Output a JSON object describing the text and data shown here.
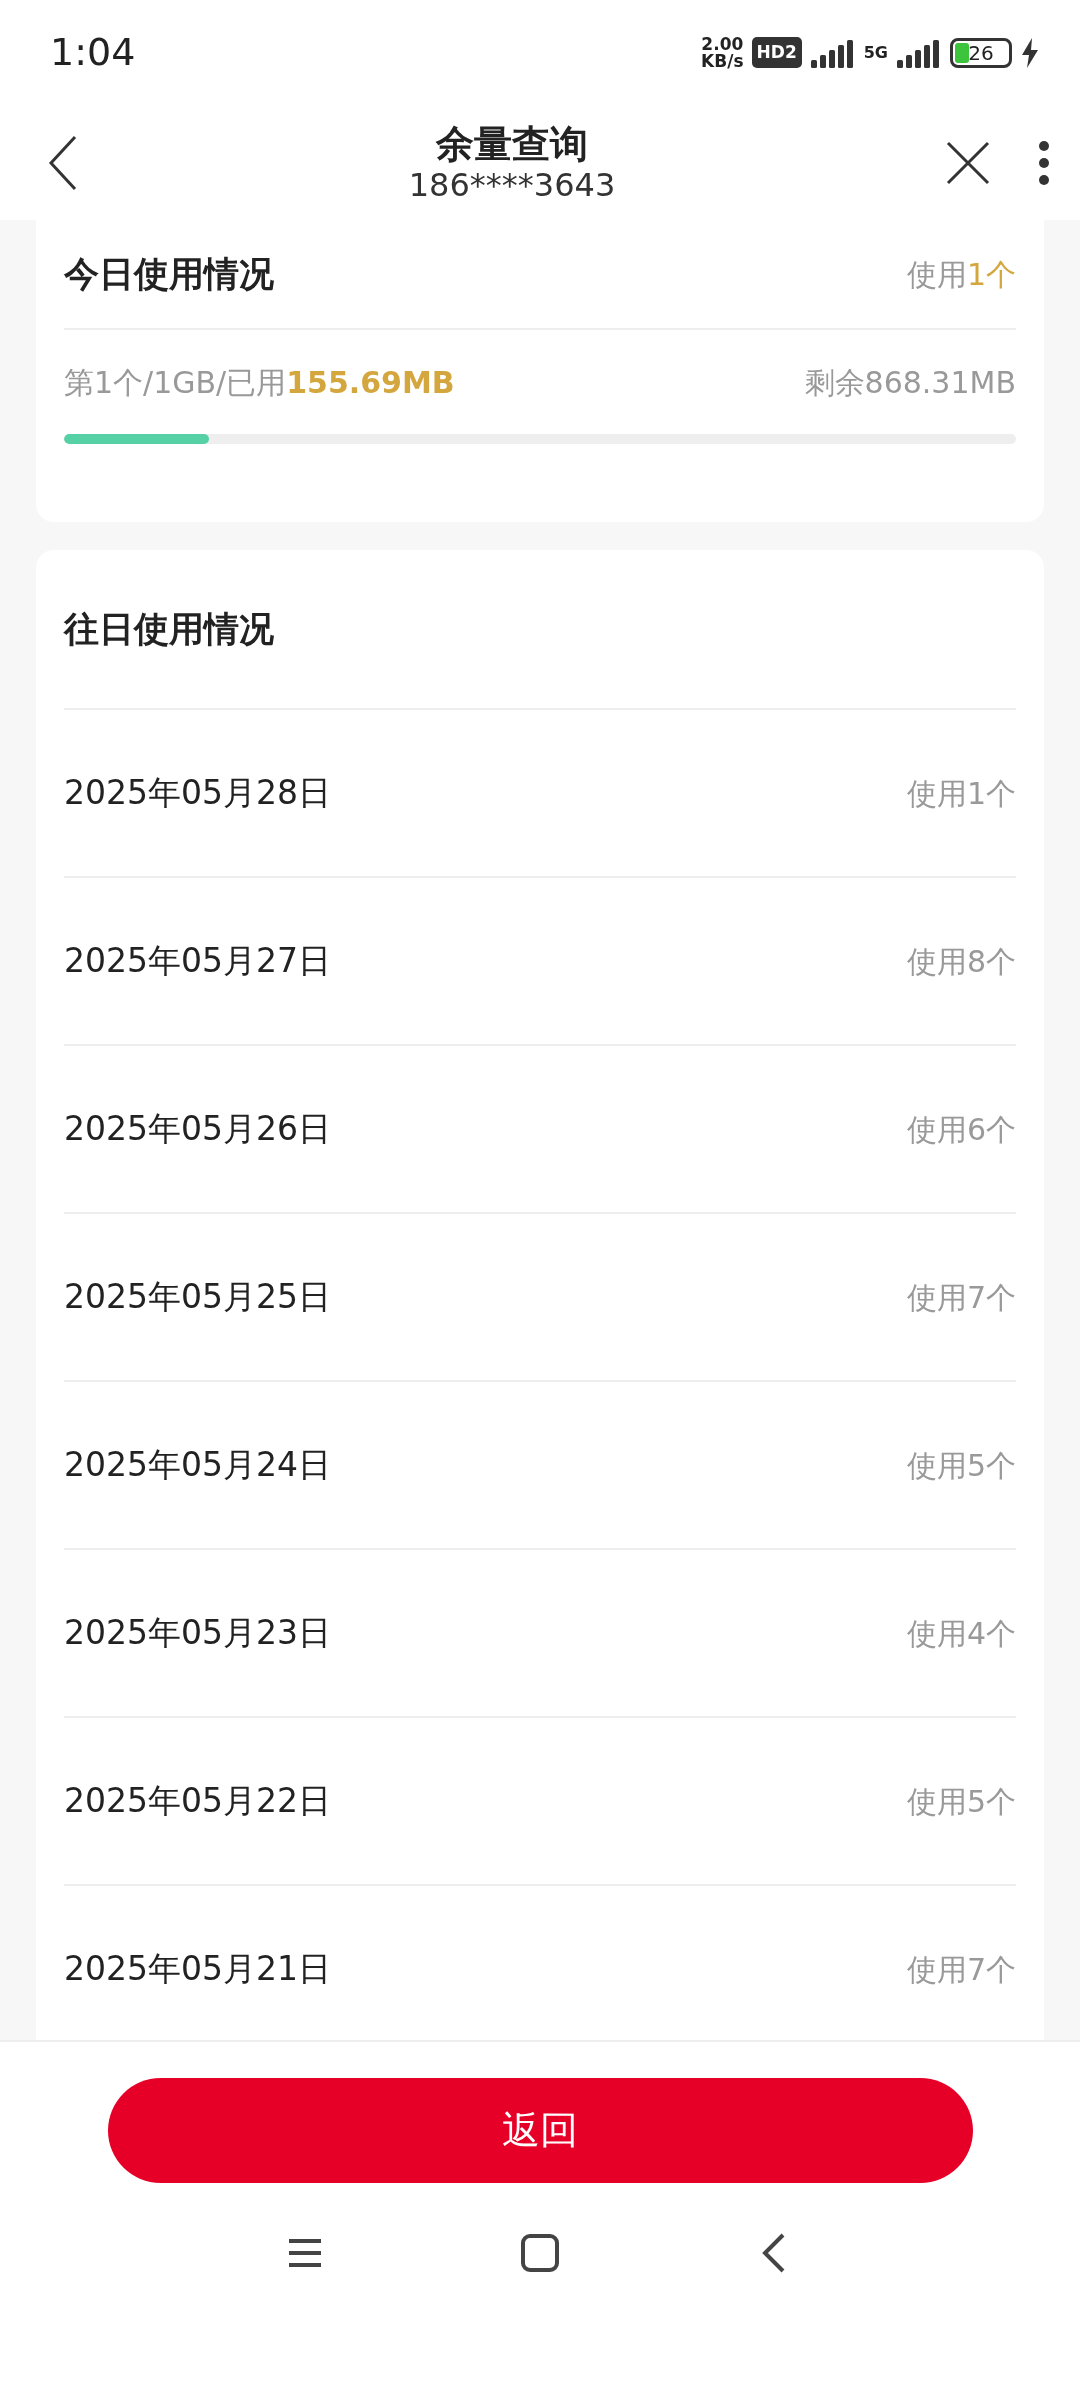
{
  "status_bar": {
    "time": "1:04",
    "speed_value": "2.00",
    "speed_unit": "KB/s",
    "hd_badge": "HD2",
    "network": "5G",
    "battery": "26",
    "charging": true
  },
  "header": {
    "title": "余量查询",
    "subtitle": "186****3643"
  },
  "today": {
    "title": "今日使用情况",
    "usage_prefix": "使用",
    "usage_highlight": "1个",
    "package_prefix": "第1个/1GB/已用",
    "package_used": "155.69MB",
    "remaining": "剩余868.31MB",
    "level": 0.152
  },
  "history": {
    "title": "往日使用情况",
    "rows": [
      {
        "date": "2025年05月28日",
        "usage": "使用1个"
      },
      {
        "date": "2025年05月27日",
        "usage": "使用8个"
      },
      {
        "date": "2025年05月26日",
        "usage": "使用6个"
      },
      {
        "date": "2025年05月25日",
        "usage": "使用7个"
      },
      {
        "date": "2025年05月24日",
        "usage": "使用5个"
      },
      {
        "date": "2025年05月23日",
        "usage": "使用4个"
      },
      {
        "date": "2025年05月22日",
        "usage": "使用5个"
      },
      {
        "date": "2025年05月21日",
        "usage": "使用7个"
      }
    ]
  },
  "back_button": "返回"
}
